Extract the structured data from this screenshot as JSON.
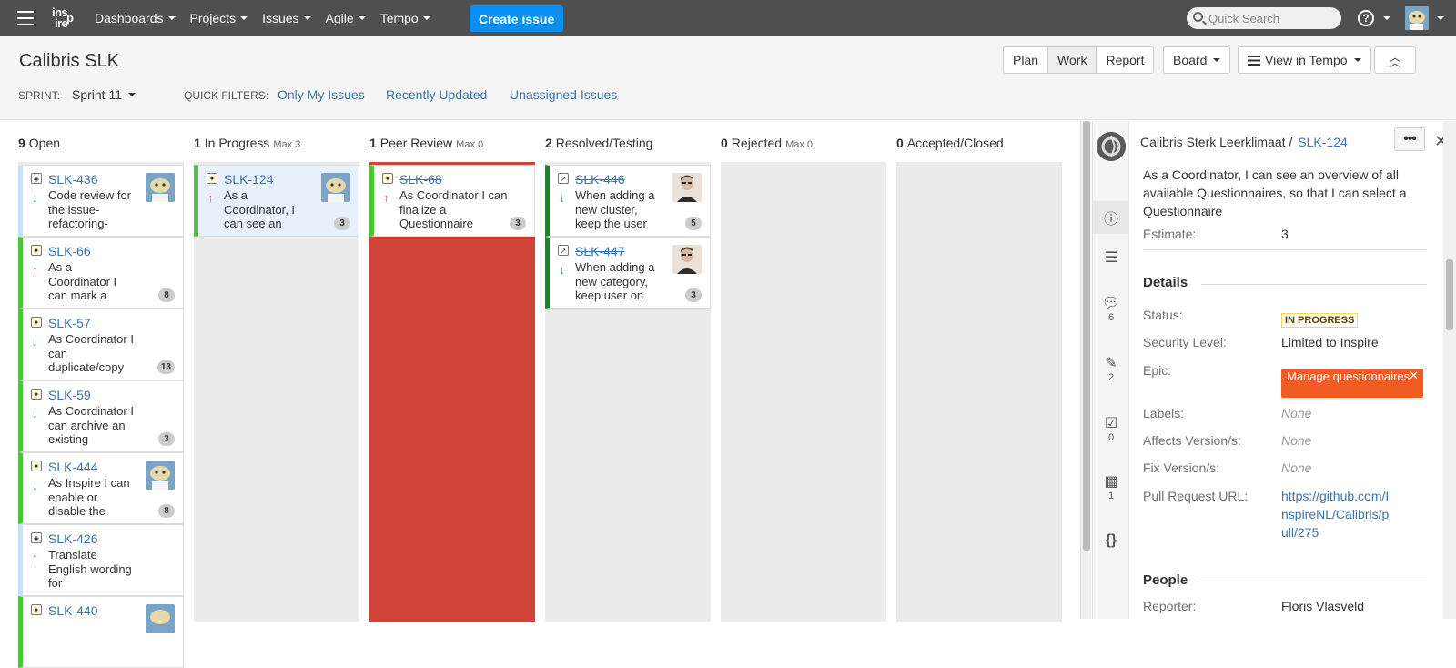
{
  "nav": {
    "items": [
      "Dashboards",
      "Projects",
      "Issues",
      "Agile",
      "Tempo"
    ],
    "create_label": "Create issue",
    "search_placeholder": "Quick Search",
    "logo_text": "inspire"
  },
  "header": {
    "title": "Calibris SLK",
    "sprint_label": "SPRINT:",
    "sprint_value": "Sprint 11",
    "quick_filters_label": "QUICK FILTERS:",
    "quick_filters": [
      "Only My Issues",
      "Recently Updated",
      "Unassigned Issues"
    ],
    "mode_buttons": [
      "Plan",
      "Work",
      "Report"
    ],
    "board_button": "Board",
    "tempo_button": "View in Tempo"
  },
  "columns": [
    {
      "count": "9",
      "name": "Open",
      "max": ""
    },
    {
      "count": "1",
      "name": "In Progress",
      "max": "Max 3"
    },
    {
      "count": "1",
      "name": "Peer Review",
      "max": "Max 0"
    },
    {
      "count": "2",
      "name": "Resolved/Testing",
      "max": ""
    },
    {
      "count": "0",
      "name": "Rejected",
      "max": "Max 0"
    },
    {
      "count": "0",
      "name": "Accepted/Closed",
      "max": ""
    }
  ],
  "cards": {
    "open": [
      {
        "key": "SLK-436",
        "summary": "Code review for the issue-refactoring-",
        "priority": "down",
        "estimate": "",
        "avatar": true
      },
      {
        "key": "SLK-66",
        "summary": "As a Coordinator I can mark a",
        "priority": "up",
        "estimate": "8",
        "avatar": false
      },
      {
        "key": "SLK-57",
        "summary": "As Coordinator I can duplicate/copy",
        "priority": "down",
        "estimate": "13",
        "avatar": false
      },
      {
        "key": "SLK-59",
        "summary": "As Coordinator I can archive an existing",
        "priority": "down",
        "estimate": "3",
        "avatar": false
      },
      {
        "key": "SLK-444",
        "summary": "As Inspire I can enable or disable the",
        "priority": "down",
        "estimate": "8",
        "avatar": true
      },
      {
        "key": "SLK-426",
        "summary": "Translate English wording for",
        "priority": "up",
        "estimate": "",
        "avatar": false
      },
      {
        "key": "SLK-440",
        "summary": "",
        "priority": "",
        "estimate": "",
        "avatar": true
      }
    ],
    "in_progress": [
      {
        "key": "SLK-124",
        "summary": "As a Coordinator, I can see an",
        "priority": "up",
        "estimate": "3",
        "avatar": true
      }
    ],
    "peer_review": [
      {
        "key": "SLK-68",
        "summary": "As Coordinator I can finalize a Questionnaire",
        "priority": "up",
        "estimate": "3",
        "avatar": false
      }
    ],
    "resolved": [
      {
        "key": "SLK-446",
        "summary": "When adding a new cluster, keep the user",
        "priority": "down",
        "estimate": "5",
        "avatar": true
      },
      {
        "key": "SLK-447",
        "summary": "When adding a new category, keep user on",
        "priority": "down",
        "estimate": "3",
        "avatar": true
      }
    ]
  },
  "detail": {
    "project": "Calibris Sterk Leerklimaat /",
    "key": "SLK-124",
    "summary": "As a Coordinator, I can see an overview of all available Questionnaires, so that I can select a Questionnaire",
    "estimate_label": "Estimate:",
    "estimate_value": "3",
    "details_title": "Details",
    "status_label": "Status:",
    "status_value": "IN PROGRESS",
    "security_label": "Security Level:",
    "security_value": "Limited to Inspire",
    "epic_label": "Epic:",
    "epic_value": "Manage questionnaires",
    "labels_label": "Labels:",
    "labels_value": "None",
    "affects_label": "Affects Version/s:",
    "affects_value": "None",
    "fix_label": "Fix Version/s:",
    "fix_value": "None",
    "pr_label": "Pull Request URL:",
    "pr_value": "https://github.com/InspireNL/Calibris/pull/275",
    "people_title": "People",
    "reporter_label": "Reporter:",
    "reporter_value": "Floris Vlasveld",
    "tab_counts": {
      "comments": "6",
      "attachments": "2",
      "subtasks": "0",
      "tempo": "1"
    }
  },
  "colors": {
    "nav_bg": "#4f4f4f",
    "create_button": "#0b8ff0",
    "link": "#3b73af",
    "peer_review_over_limit": "#d04437",
    "epic": "#f15c22"
  }
}
